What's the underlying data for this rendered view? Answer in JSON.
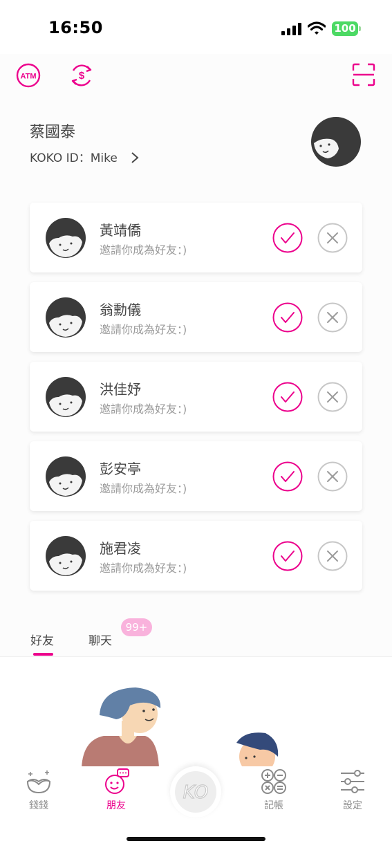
{
  "status_bar": {
    "time": "16:50",
    "battery": "100"
  },
  "colors": {
    "accent": "#ec008c",
    "badge": "#f9b2dc",
    "battery": "#4cd964"
  },
  "header": {
    "icons": [
      "atm-icon",
      "currency-exchange-icon",
      "scan-icon"
    ],
    "atm_label": "ATM"
  },
  "user": {
    "name": "蔡國泰",
    "id_line": "KOKO ID：Mike"
  },
  "requests": [
    {
      "name": "黃靖僑",
      "message": "邀請你成為好友：)"
    },
    {
      "name": "翁勳儀",
      "message": "邀請你成為好友：)"
    },
    {
      "name": "洪佳妤",
      "message": "邀請你成為好友：)"
    },
    {
      "name": "彭安亭",
      "message": "邀請你成為好友：)"
    },
    {
      "name": "施君凌",
      "message": "邀請你成為好友：)"
    }
  ],
  "tabs": {
    "friends": "好友",
    "chat": "聊天",
    "chat_badge": "99+",
    "active": "friends"
  },
  "bottom_nav": {
    "money": "錢錢",
    "friends": "朋友",
    "center": "KO",
    "accounting": "記帳",
    "settings": "設定",
    "active": "friends"
  }
}
